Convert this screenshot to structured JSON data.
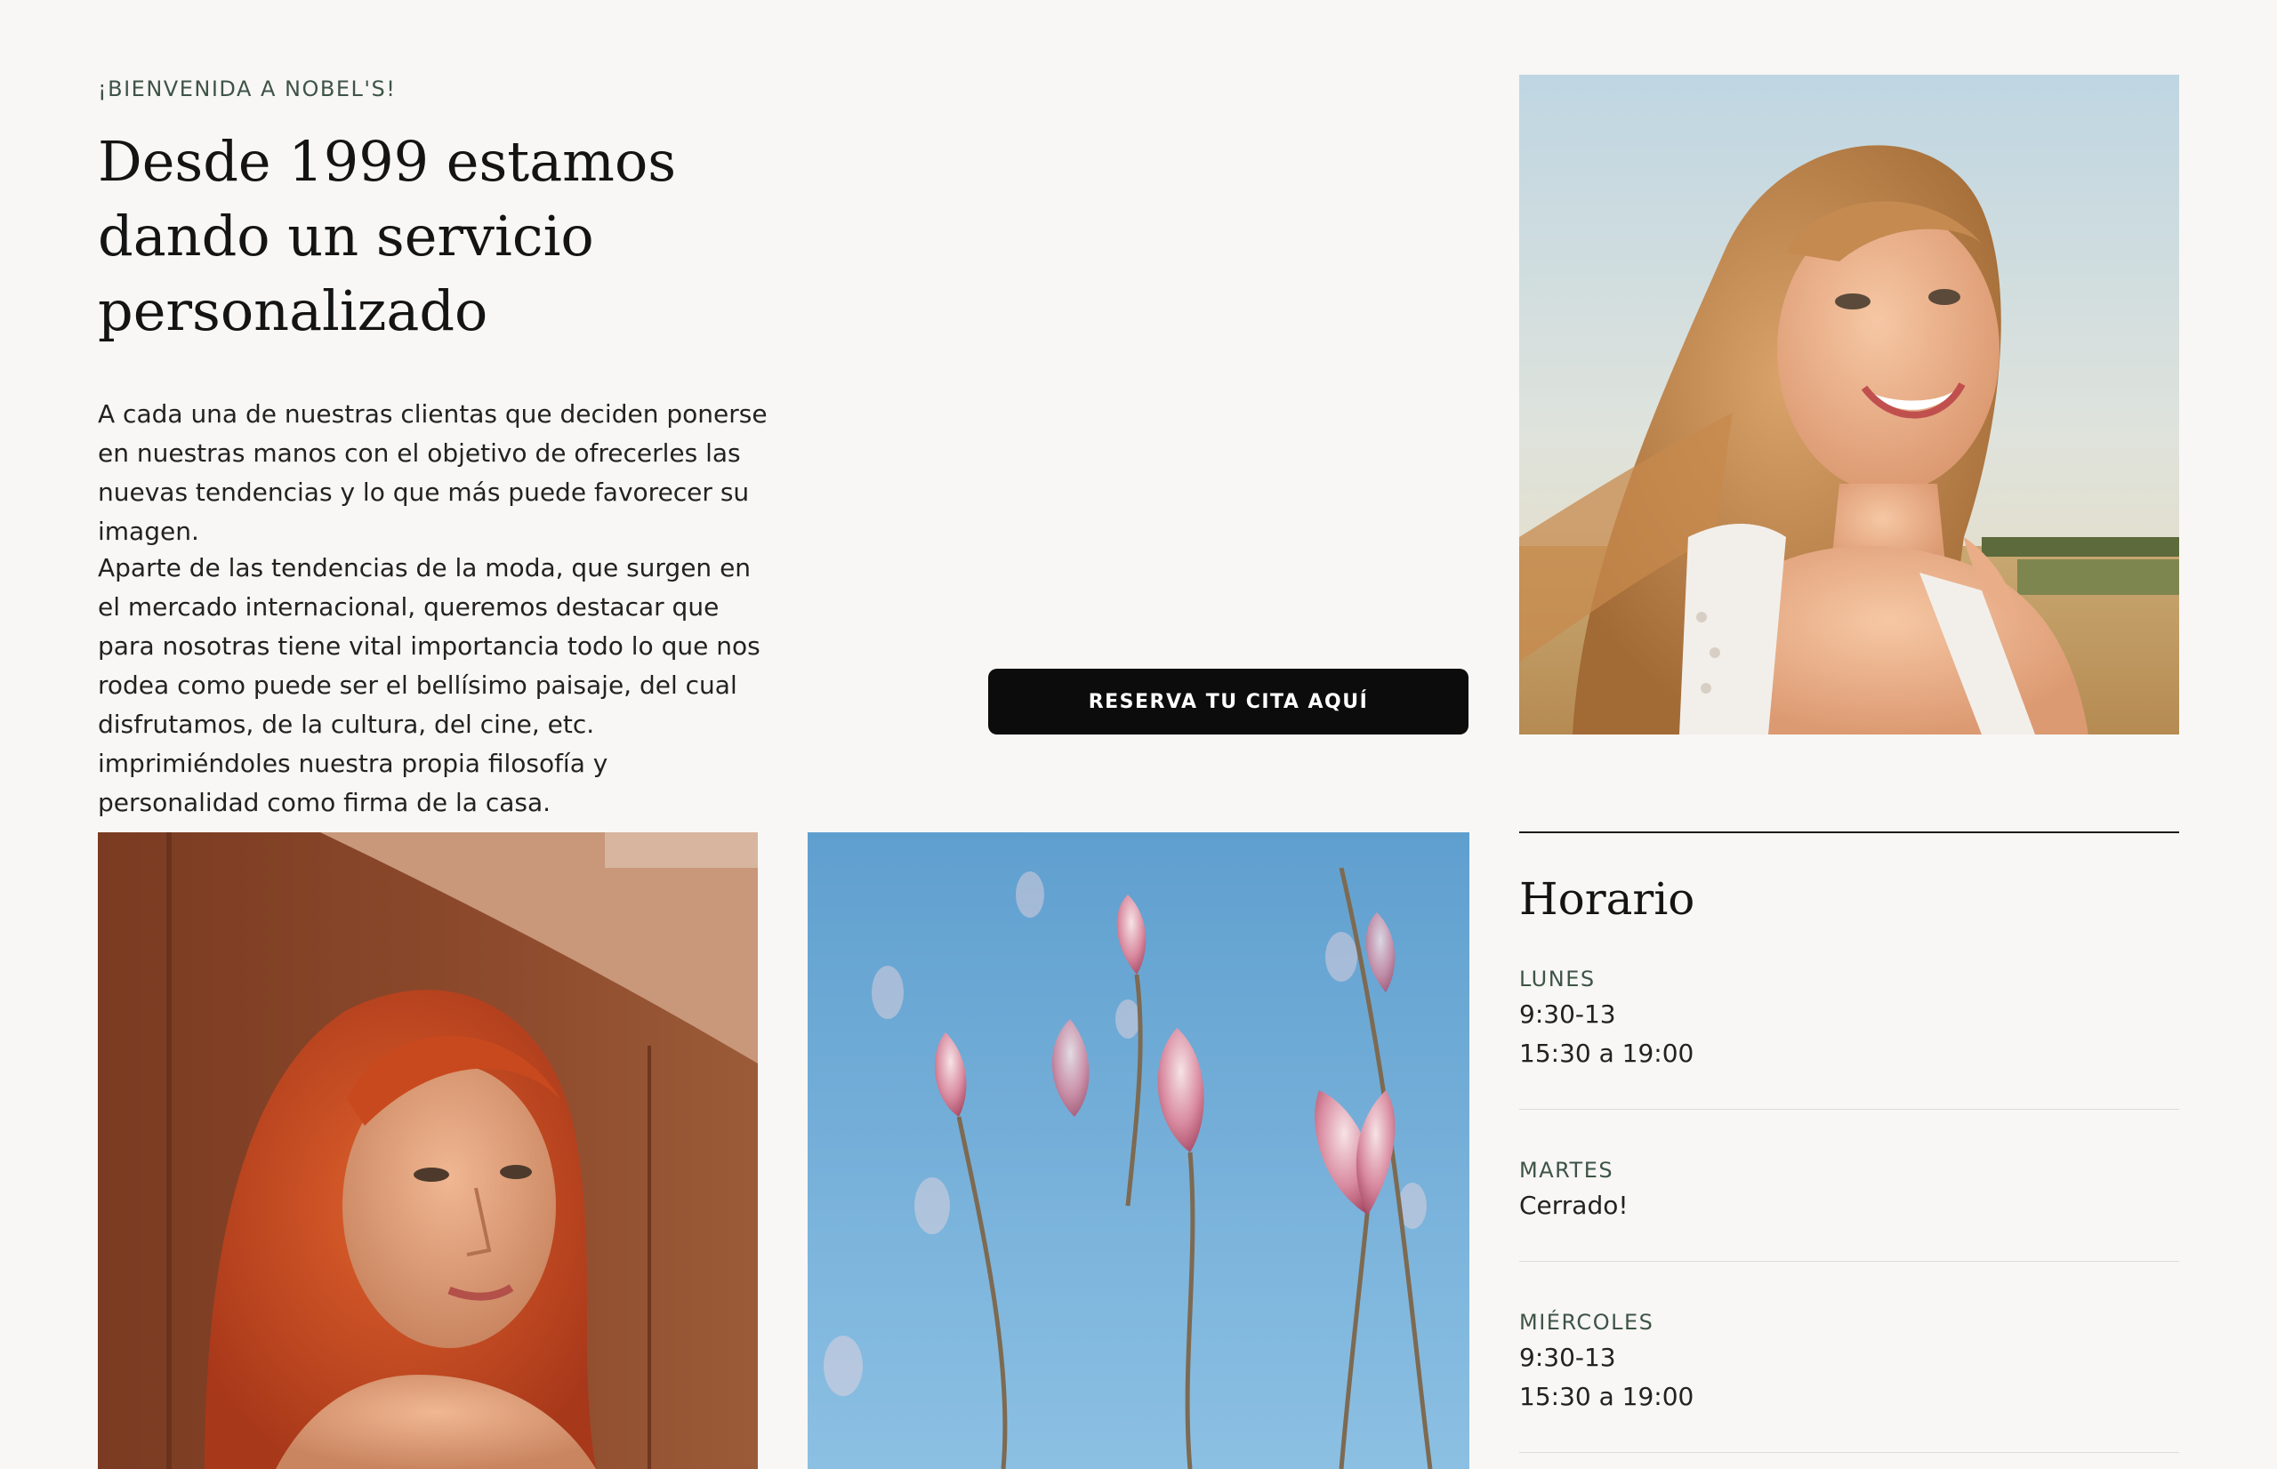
{
  "intro": {
    "eyebrow": "¡BIENVENIDA A NOBEL'S!",
    "headline": "Desde 1999 estamos dando un servicio personalizado",
    "paragraph_1": "A cada una de nuestras clientas que deciden ponerse en nuestras manos con el objetivo de ofrecerles las nuevas tendencias y lo que más puede favorecer su imagen.",
    "paragraph_2": "Aparte de las tendencias de la moda, que surgen en el mercado internacional, queremos destacar que para nosotras tiene vital importancia todo lo que nos rodea como puede ser el bellísimo paisaje, del cual disfrutamos, de la cultura, del cine, etc. imprimiéndoles nuestra propia filosofía y personalidad como firma de la casa."
  },
  "cta": {
    "label": "RESERVA TU CITA AQUÍ"
  },
  "hours": {
    "title": "Horario",
    "days": [
      {
        "name": "LUNES",
        "slots": [
          "9:30-13",
          "15:30 a 19:00"
        ]
      },
      {
        "name": "MARTES",
        "slots": [
          "Cerrado!"
        ]
      },
      {
        "name": "MIÉRCOLES",
        "slots": [
          "9:30-13",
          "15:30 a 19:00"
        ]
      }
    ]
  },
  "colors": {
    "background": "#f8f7f5",
    "accent_label": "#3e5446",
    "button": "#0c0c0c"
  }
}
